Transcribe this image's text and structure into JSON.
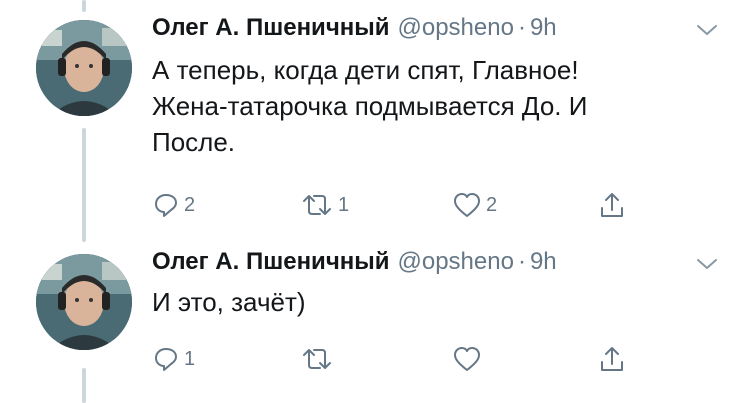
{
  "tweets": [
    {
      "author_name": "Олег А. Пшеничный",
      "handle": "@opsheno",
      "separator": "·",
      "time": "9h",
      "text_lines": [
        "А теперь, когда дети спят, Главное!",
        "Жена-татарочка подмывается До. И",
        "После."
      ],
      "reply_count": "2",
      "retweet_count": "1",
      "like_count": "2"
    },
    {
      "author_name": "Олег А. Пшеничный",
      "handle": "@opsheno",
      "separator": "·",
      "time": "9h",
      "text_lines": [
        "И это, зачёт)"
      ],
      "reply_count": "1",
      "retweet_count": "",
      "like_count": ""
    }
  ],
  "icons": {
    "reply": "reply-icon",
    "retweet": "retweet-icon",
    "like": "heart-icon",
    "share": "share-icon",
    "menu": "chevron-down-icon"
  },
  "colors": {
    "text": "#14171a",
    "secondary": "#657786",
    "thread_line": "#ccd6dd"
  }
}
